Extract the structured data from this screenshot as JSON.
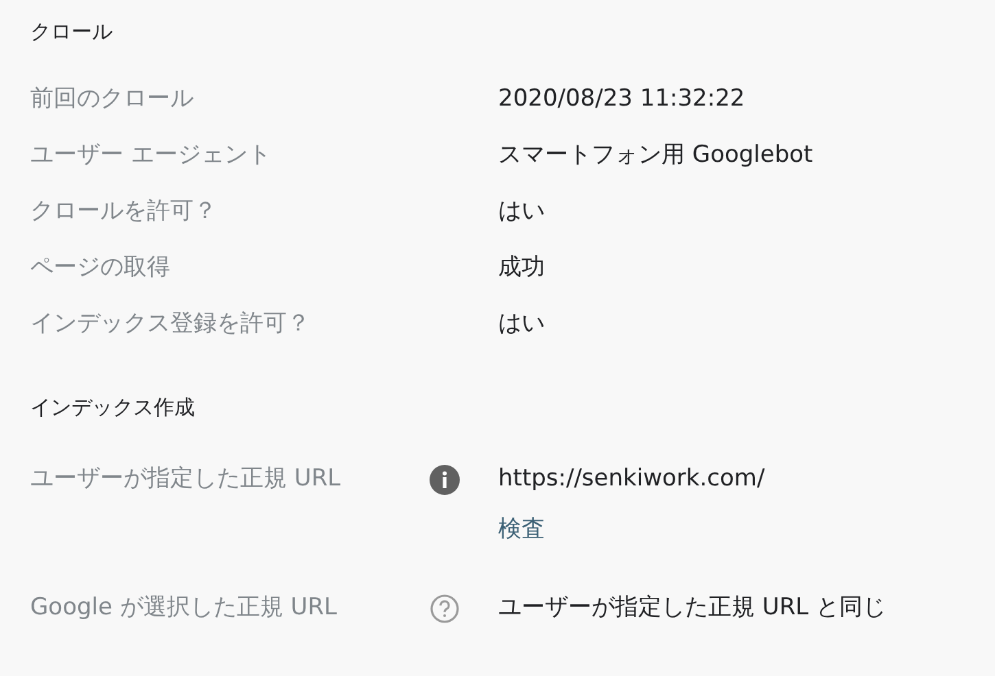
{
  "sections": [
    {
      "title": "クロール",
      "rows": [
        {
          "label": "前回のクロール",
          "values": [
            {
              "kind": "text",
              "text": "2020/08/23 11:32:22"
            }
          ]
        },
        {
          "label": "ユーザー エージェント",
          "values": [
            {
              "kind": "text",
              "text": "スマートフォン用 Googlebot"
            }
          ]
        },
        {
          "label": "クロールを許可？",
          "values": [
            {
              "kind": "text",
              "text": "はい"
            }
          ]
        },
        {
          "label": "ページの取得",
          "values": [
            {
              "kind": "text",
              "text": "成功"
            }
          ]
        },
        {
          "label": "インデックス登録を許可？",
          "values": [
            {
              "kind": "text",
              "text": "はい"
            }
          ]
        }
      ]
    },
    {
      "title": "インデックス作成",
      "rows": [
        {
          "label": "ユーザーが指定した正規 URL",
          "kind": "info",
          "values": [
            {
              "kind": "text",
              "text": "https://senkiwork.com/"
            },
            {
              "kind": "link",
              "text": "検査"
            }
          ]
        },
        {
          "label": "Google が選択した正規 URL",
          "kind": "help",
          "values": [
            {
              "kind": "text",
              "text": "ユーザーが指定した正規 URL と同じ"
            }
          ]
        }
      ]
    }
  ]
}
